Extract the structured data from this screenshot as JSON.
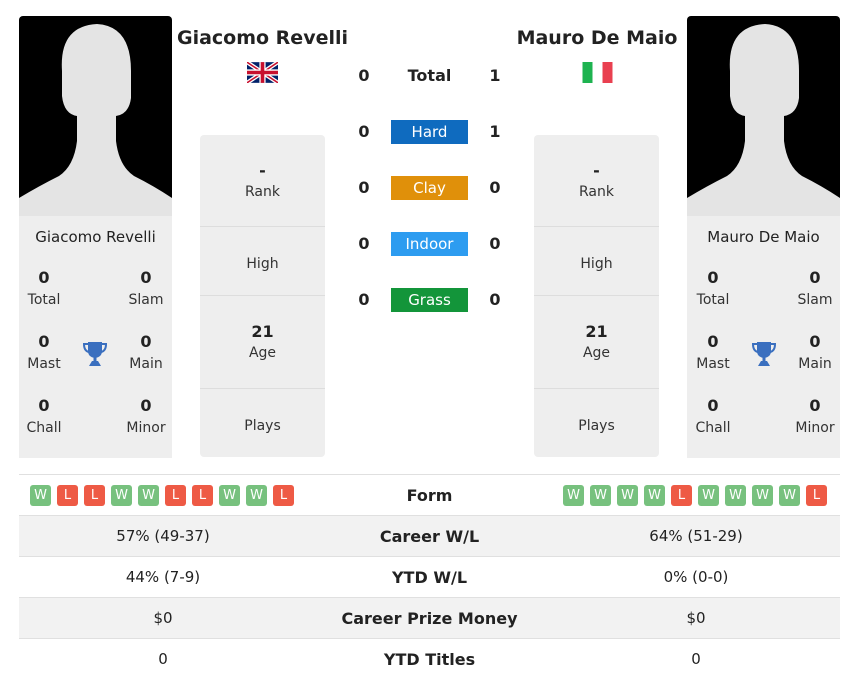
{
  "player1": {
    "name": "Giacomo Revelli",
    "flag": "united-kingdom-flag",
    "stats": {
      "total": {
        "value": "0",
        "label": "Total"
      },
      "slam": {
        "value": "0",
        "label": "Slam"
      },
      "mast": {
        "value": "0",
        "label": "Mast"
      },
      "main": {
        "value": "0",
        "label": "Main"
      },
      "chall": {
        "value": "0",
        "label": "Chall"
      },
      "minor": {
        "value": "0",
        "label": "Minor"
      }
    },
    "rank": {
      "value": "-",
      "label": "Rank"
    },
    "high": {
      "value": "",
      "label": "High"
    },
    "age": {
      "value": "21",
      "label": "Age"
    },
    "plays": {
      "value": "",
      "label": "Plays"
    },
    "form": [
      "W",
      "L",
      "L",
      "W",
      "W",
      "L",
      "L",
      "W",
      "W",
      "L"
    ],
    "career_wl": "57% (49-37)",
    "ytd_wl": "44% (7-9)",
    "prize_money": "$0",
    "ytd_titles": "0"
  },
  "player2": {
    "name": "Mauro De Maio",
    "flag": "italy-flag",
    "stats": {
      "total": {
        "value": "0",
        "label": "Total"
      },
      "slam": {
        "value": "0",
        "label": "Slam"
      },
      "mast": {
        "value": "0",
        "label": "Mast"
      },
      "main": {
        "value": "0",
        "label": "Main"
      },
      "chall": {
        "value": "0",
        "label": "Chall"
      },
      "minor": {
        "value": "0",
        "label": "Minor"
      }
    },
    "rank": {
      "value": "-",
      "label": "Rank"
    },
    "high": {
      "value": "",
      "label": "High"
    },
    "age": {
      "value": "21",
      "label": "Age"
    },
    "plays": {
      "value": "",
      "label": "Plays"
    },
    "form": [
      "W",
      "W",
      "W",
      "W",
      "L",
      "W",
      "W",
      "W",
      "W",
      "L"
    ],
    "career_wl": "64% (51-29)",
    "ytd_wl": "0% (0-0)",
    "prize_money": "$0",
    "ytd_titles": "0"
  },
  "h2h": {
    "total": {
      "label": "Total",
      "p1": "0",
      "p2": "1"
    },
    "surfaces": [
      {
        "label": "Hard",
        "p1": "0",
        "p2": "1",
        "color": "#0f6bbf"
      },
      {
        "label": "Clay",
        "p1": "0",
        "p2": "0",
        "color": "#e0900a"
      },
      {
        "label": "Indoor",
        "p1": "0",
        "p2": "0",
        "color": "#2d9cf0"
      },
      {
        "label": "Grass",
        "p1": "0",
        "p2": "0",
        "color": "#13953a"
      }
    ]
  },
  "compare": {
    "form_label": "Form",
    "career_wl_label": "Career W/L",
    "ytd_wl_label": "YTD W/L",
    "prize_label": "Career Prize Money",
    "titles_label": "YTD Titles"
  }
}
